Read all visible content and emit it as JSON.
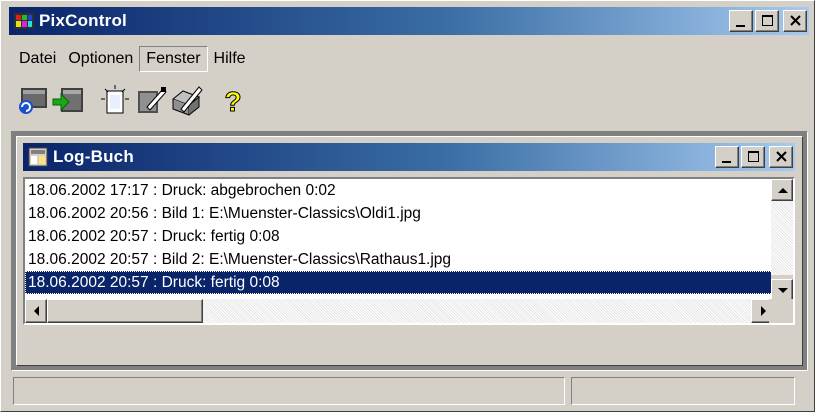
{
  "window": {
    "title": "PixControl",
    "icon": "pixcontrol-app-icon"
  },
  "title_buttons": {
    "minimize_icon": "minimize-icon",
    "maximize_icon": "maximize-icon",
    "close_icon": "close-icon"
  },
  "menu": {
    "items": [
      {
        "label": "Datei"
      },
      {
        "label": "Optionen"
      },
      {
        "label": "Fenster",
        "active": true
      },
      {
        "label": "Hilfe"
      }
    ]
  },
  "toolbar": {
    "buttons": [
      {
        "icon": "scan-image-icon"
      },
      {
        "icon": "import-image-icon"
      },
      {
        "icon": "new-page-icon"
      },
      {
        "icon": "print-setup-icon"
      },
      {
        "icon": "print-tools-icon"
      },
      {
        "icon": "help-icon",
        "glyph": "?"
      }
    ]
  },
  "log_window": {
    "title": "Log-Buch",
    "icon": "log-book-icon",
    "entries": [
      "18.06.2002 17:17 : Druck: abgebrochen 0:02",
      "18.06.2002 20:56 : Bild 1: E:\\Muenster-Classics\\Oldi1.jpg",
      "18.06.2002 20:57 : Druck: fertig 0:08",
      "18.06.2002 20:57 : Bild 2: E:\\Muenster-Classics\\Rathaus1.jpg",
      "18.06.2002 20:57 : Druck: fertig 0:08"
    ],
    "selected_index": 4
  },
  "colors": {
    "titlebar_start": "#0a246a",
    "titlebar_end": "#a6caf0",
    "face": "#d4d0c8",
    "selection": "#0a246a"
  }
}
